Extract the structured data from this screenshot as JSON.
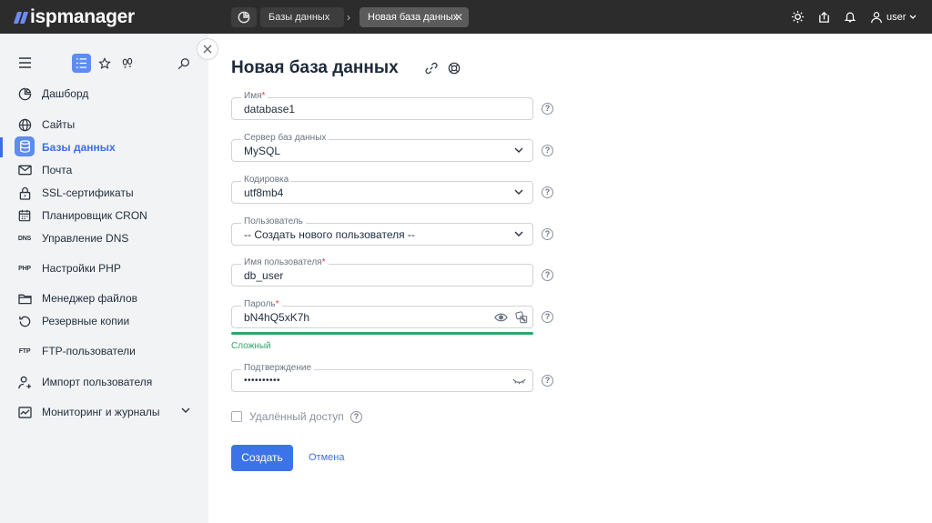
{
  "app": {
    "logo_text": "ispmanager"
  },
  "topbar": {
    "tabs": [
      {
        "label": "Базы данных"
      },
      {
        "label": "Новая база данных"
      }
    ],
    "separator": "›",
    "user_label": "user"
  },
  "sidebar": {
    "items": [
      {
        "label": "Дашборд",
        "icon": "dashboard-icon"
      },
      {
        "label": "Сайты",
        "icon": "globe-icon"
      },
      {
        "label": "Базы данных",
        "icon": "database-icon",
        "active": true
      },
      {
        "label": "Почта",
        "icon": "mail-icon"
      },
      {
        "label": "SSL-сертификаты",
        "icon": "lock-icon"
      },
      {
        "label": "Планировщик CRON",
        "icon": "calendar-icon"
      },
      {
        "label": "Управление DNS",
        "icon": "dns-icon",
        "icon_text": "DNS"
      },
      {
        "label": "Настройки PHP",
        "icon": "php-icon",
        "icon_text": "PHP"
      },
      {
        "label": "Менеджер файлов",
        "icon": "folder-icon"
      },
      {
        "label": "Резервные копии",
        "icon": "backup-icon"
      },
      {
        "label": "FTP-пользователи",
        "icon": "ftp-icon",
        "icon_text": "FTP"
      },
      {
        "label": "Импорт пользователя",
        "icon": "user-import-icon"
      },
      {
        "label": "Мониторинг и журналы",
        "icon": "monitoring-icon"
      }
    ]
  },
  "page": {
    "title": "Новая база данных"
  },
  "form": {
    "name": {
      "label": "Имя",
      "required_mark": "*",
      "value": "database1"
    },
    "server": {
      "label": "Сервер баз данных",
      "value": "MySQL"
    },
    "encoding": {
      "label": "Кодировка",
      "value": "utf8mb4"
    },
    "user": {
      "label": "Пользователь",
      "value": "-- Создать нового пользователя --"
    },
    "username": {
      "label": "Имя пользователя",
      "required_mark": "*",
      "value": "db_user"
    },
    "password": {
      "label": "Пароль",
      "required_mark": "*",
      "value": "bN4hQ5xK7h"
    },
    "password_strength": {
      "label": "Сложный",
      "level": 1.0
    },
    "confirm": {
      "label": "Подтверждение",
      "value": "••••••••••"
    },
    "remote_access": {
      "label": "Удалённый доступ",
      "checked": false
    },
    "help_symbol": "?"
  },
  "actions": {
    "submit_label": "Создать",
    "cancel_label": "Отмена"
  },
  "colors": {
    "accent": "#3d73e8",
    "topbar": "#2c2c2c",
    "sidebar": "#f2f3f4",
    "strength": "#2ea66b",
    "required": "#e53935"
  }
}
